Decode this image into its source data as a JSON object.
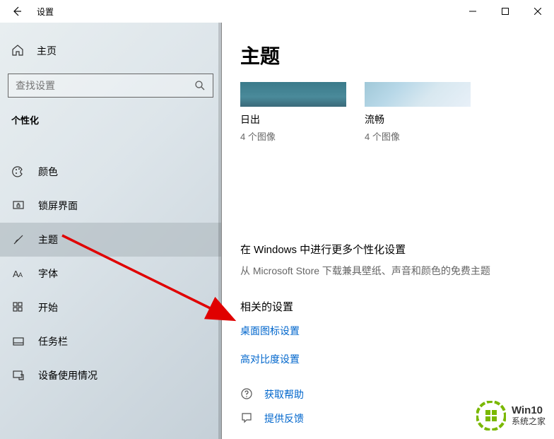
{
  "titlebar": {
    "title": "设置"
  },
  "sidebar": {
    "home": "主页",
    "search_placeholder": "查找设置",
    "category": "个性化",
    "items": [
      {
        "label": "颜色",
        "icon": "palette"
      },
      {
        "label": "锁屏界面",
        "icon": "lock-screen"
      },
      {
        "label": "主题",
        "icon": "brush",
        "active": true
      },
      {
        "label": "字体",
        "icon": "font"
      },
      {
        "label": "开始",
        "icon": "start-grid"
      },
      {
        "label": "任务栏",
        "icon": "taskbar"
      },
      {
        "label": "设备使用情况",
        "icon": "device-usage"
      }
    ]
  },
  "content": {
    "title": "主题",
    "themes": [
      {
        "name": "日出",
        "sub": "4 个图像",
        "style": "sunrise"
      },
      {
        "name": "流畅",
        "sub": "4 个图像",
        "style": "smooth"
      }
    ],
    "more_settings": {
      "heading": "在 Windows 中进行更多个性化设置",
      "sub": "从 Microsoft Store 下载兼具壁纸、声音和颜色的免费主题"
    },
    "related": {
      "heading": "相关的设置",
      "links": [
        "桌面图标设置",
        "高对比度设置"
      ]
    },
    "footer": [
      {
        "label": "获取帮助",
        "icon": "help"
      },
      {
        "label": "提供反馈",
        "icon": "feedback"
      }
    ]
  },
  "watermark": {
    "line1": "Win10",
    "line2": "系统之家"
  }
}
